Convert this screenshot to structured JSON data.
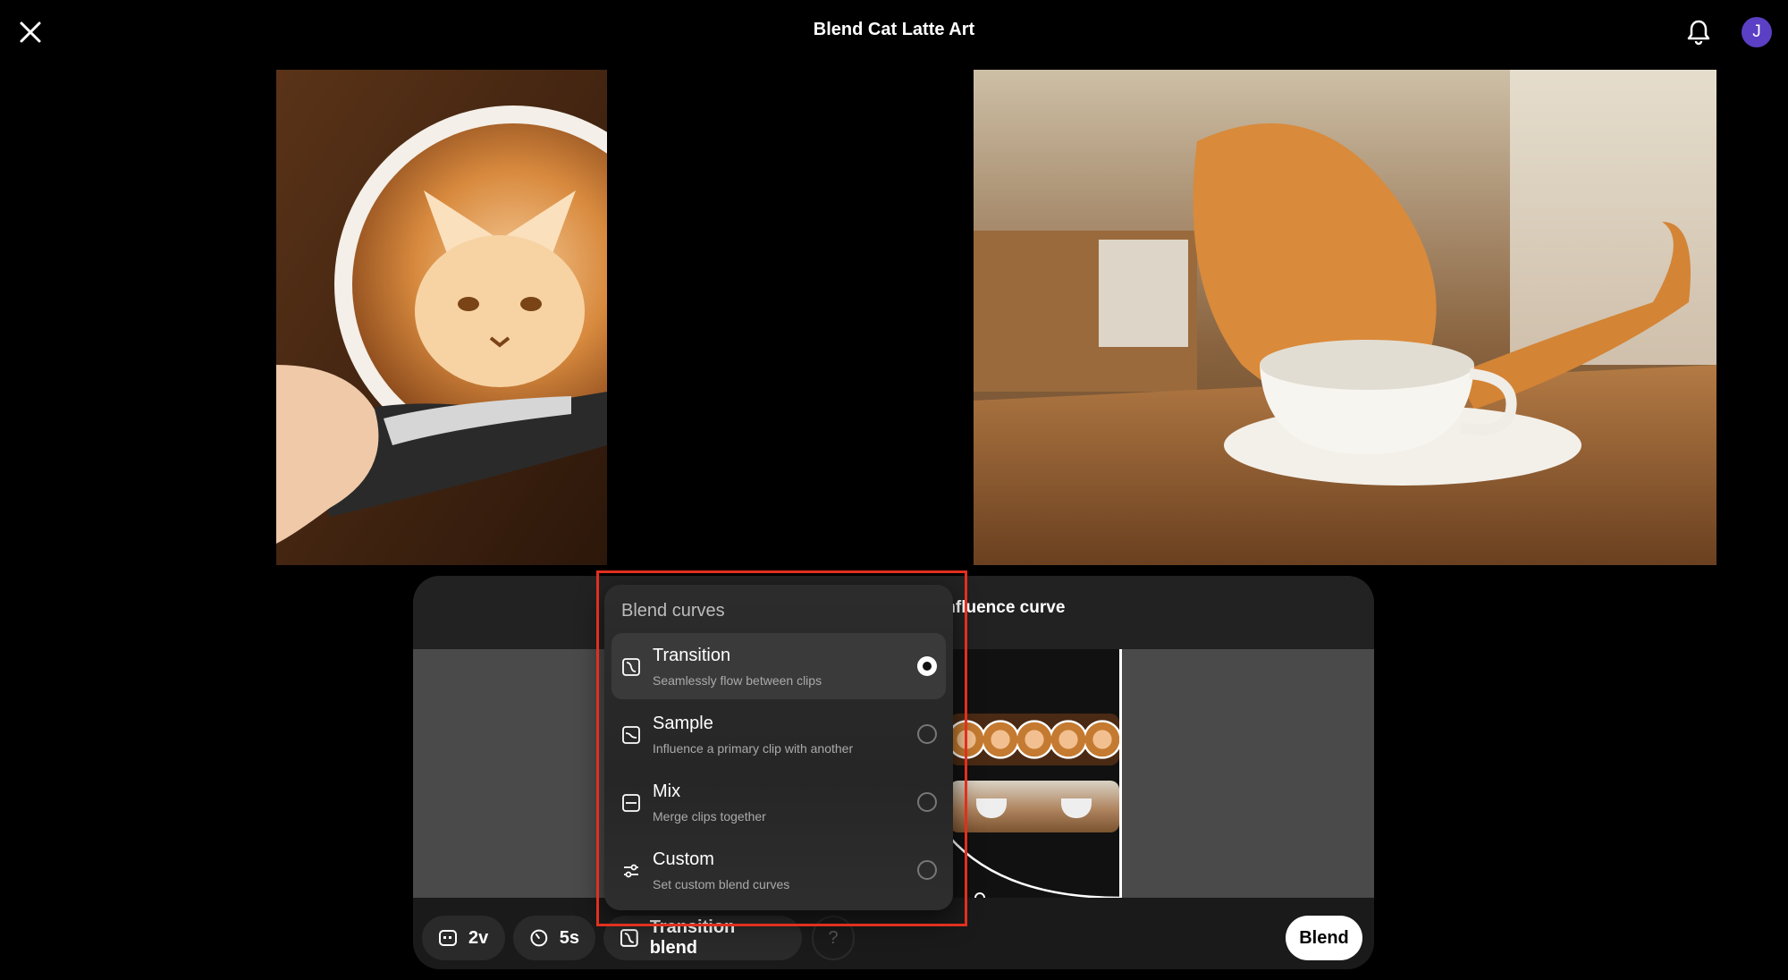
{
  "header": {
    "title": "Blend Cat Latte Art",
    "avatar_initial": "J"
  },
  "panel": {
    "title": "Influence curve"
  },
  "footer": {
    "videos_label": "2v",
    "duration_label": "5s",
    "blend_mode_label": "Transition blend",
    "help_label": "?",
    "blend_button_label": "Blend"
  },
  "dropdown": {
    "title": "Blend curves",
    "options": [
      {
        "label": "Transition",
        "description": "Seamlessly flow between clips",
        "selected": true,
        "icon": "transition-curve-icon"
      },
      {
        "label": "Sample",
        "description": "Influence a primary clip with another",
        "selected": false,
        "icon": "sample-curve-icon"
      },
      {
        "label": "Mix",
        "description": "Merge clips together",
        "selected": false,
        "icon": "mix-curve-icon"
      },
      {
        "label": "Custom",
        "description": "Set custom blend curves",
        "selected": false,
        "icon": "sliders-icon"
      }
    ]
  },
  "colors": {
    "background": "#000000",
    "panel": "#1a1a1a",
    "avatar": "#5b3fc4",
    "highlight": "#e0301e"
  }
}
